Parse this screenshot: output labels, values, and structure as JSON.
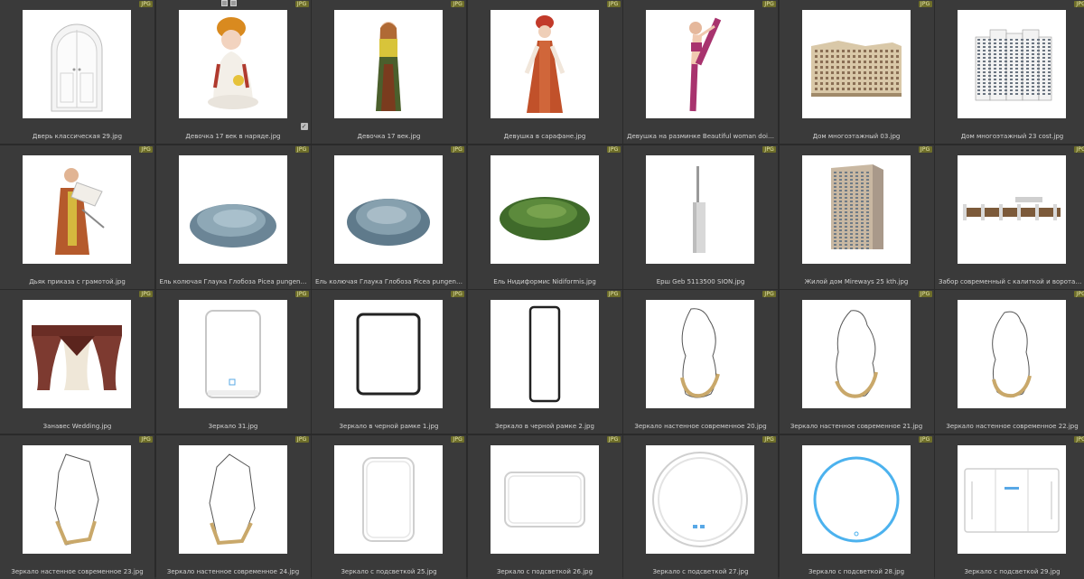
{
  "badge_label": "JPG",
  "items": [
    {
      "caption": "Дверь классическая 29.jpg",
      "icon": "door-arch"
    },
    {
      "caption": "Девочка 17 век в наряде.jpg",
      "icon": "girl-sitting"
    },
    {
      "caption": "Девочка 17 век.jpg",
      "icon": "girl-dress"
    },
    {
      "caption": "Девушка в сарафане.jpg",
      "icon": "woman-sarafan"
    },
    {
      "caption": "Девушка на разминке Beautiful woman doing gymnastics...",
      "icon": "woman-gym"
    },
    {
      "caption": "Дом многоэтажный 03.jpg",
      "icon": "building-low"
    },
    {
      "caption": "Дом многоэтажный 23 cost.jpg",
      "icon": "building-white"
    },
    {
      "caption": "Дьяк приказа с грамотой.jpg",
      "icon": "man-scroll"
    },
    {
      "caption": "Ель колючая Глаука Глобоза Picea pungens Glauca Globo...",
      "icon": "spruce-blue"
    },
    {
      "caption": "Ель колючая Глаука Глобоза Picea pungens Glauca Globo...",
      "icon": "spruce-blue-2"
    },
    {
      "caption": "Ель Нидиформис Nidiformis.jpg",
      "icon": "spruce-green"
    },
    {
      "caption": "Ерш Geb 5113500 SION.jpg",
      "icon": "toilet-brush"
    },
    {
      "caption": "Жилой дом Mireways 25 kth.jpg",
      "icon": "building-tall"
    },
    {
      "caption": "Забор современный с калиткой и воротами Modern fen...",
      "icon": "fence"
    },
    {
      "caption": "Занавес Wedding.jpg",
      "icon": "curtain"
    },
    {
      "caption": "Зеркало 31.jpg",
      "icon": "mirror-rounded"
    },
    {
      "caption": "Зеркало в черной рамке 1.jpg",
      "icon": "mirror-black"
    },
    {
      "caption": "Зеркало в черной рамке 2.jpg",
      "icon": "mirror-tall-black"
    },
    {
      "caption": "Зеркало настенное современное 20.jpg",
      "icon": "mirror-organic"
    },
    {
      "caption": "Зеркало настенное современное 21.jpg",
      "icon": "mirror-organic-2"
    },
    {
      "caption": "Зеркало настенное современное 22.jpg",
      "icon": "mirror-organic-3"
    },
    {
      "caption": "Зеркало настенное современное 23.jpg",
      "icon": "mirror-facet"
    },
    {
      "caption": "Зеркало настенное современное 24.jpg",
      "icon": "mirror-facet-2"
    },
    {
      "caption": "Зеркало с подсветкой 25.jpg",
      "icon": "mirror-led-rect"
    },
    {
      "caption": "Зеркало с подсветкой 26.jpg",
      "icon": "mirror-led-wide"
    },
    {
      "caption": "Зеркало с подсветкой 27.jpg",
      "icon": "mirror-led-round"
    },
    {
      "caption": "Зеркало с подсветкой 28.jpg",
      "icon": "mirror-led-round-blue"
    },
    {
      "caption": "Зеркало с подсветкой 29.jpg",
      "icon": "mirror-led-triple"
    }
  ]
}
